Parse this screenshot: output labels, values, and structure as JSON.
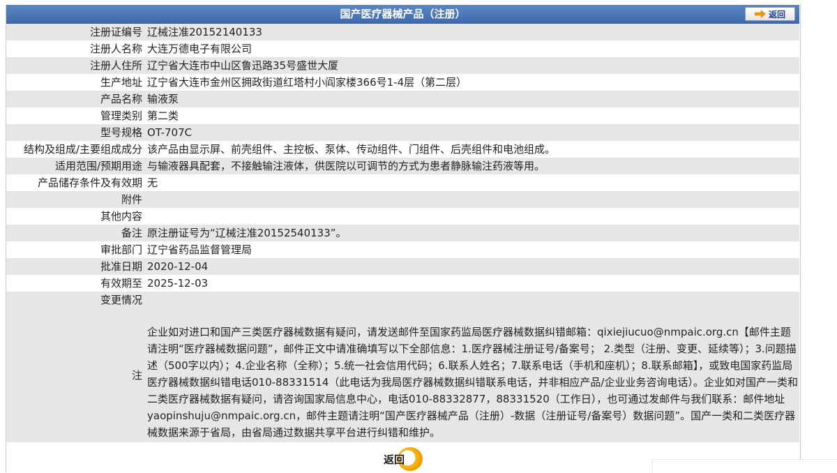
{
  "header": {
    "title": "国产医疗器械产品（注册）",
    "back_label": "返回"
  },
  "rows": [
    {
      "label": "注册证编号",
      "value": "辽械注准20152140133"
    },
    {
      "label": "注册人名称",
      "value": "大连万德电子有限公司"
    },
    {
      "label": "注册人住所",
      "value": "辽宁省大连市中山区鲁迅路35号盛世大厦"
    },
    {
      "label": "生产地址",
      "value": "辽宁省大连市金州区拥政街道红塔村小阎家楼366号1-4层（第二层）"
    },
    {
      "label": "产品名称",
      "value": "输液泵"
    },
    {
      "label": "管理类别",
      "value": "第二类"
    },
    {
      "label": "型号规格",
      "value": "OT-707C"
    },
    {
      "label": "结构及组成/主要组成成分",
      "value": "该产品由显示屏、前壳组件、主控板、泵体、传动组件、门组件、后壳组件和电池组成。"
    },
    {
      "label": "适用范围/预期用途",
      "value": "与输液器具配套，不接触输注液体，供医院以可调节的方式为患者静脉输注药液等用。"
    },
    {
      "label": "产品储存条件及有效期",
      "value": "无"
    },
    {
      "label": "附件",
      "value": ""
    },
    {
      "label": "其他内容",
      "value": ""
    },
    {
      "label": "备注",
      "value": "原注册证号为“辽械注准20152540133”。"
    },
    {
      "label": "审批部门",
      "value": "辽宁省药品监督管理局"
    },
    {
      "label": "批准日期",
      "value": "2020-12-04"
    },
    {
      "label": "有效期至",
      "value": "2025-12-03"
    },
    {
      "label": "变更情况",
      "value": ""
    }
  ],
  "note": {
    "label": "注",
    "text": "企业如对进口和国产三类医疗器械数据有疑问，请发送邮件至国家药监局医疗器械数据纠错邮箱：qixiejiucuo@nmpaic.org.cn【邮件主题请注明“医疗器械数据问题”，邮件正文中请准确填写以下全部信息：1.医疗器械注册证号/备案号； 2.类型（注册、变更、延续等）；3.问题描述（500字以内）；4.企业名称（全称）；5.统一社会信用代码；6.联系人姓名；7.联系电话（手机和座机）；8.联系邮箱】，或致电国家药监局医疗器械数据纠错电话010-88331514（此电话为我局医疗器械数据纠错联系电话，并非相应产品/企业业务咨询电话）。企业如对国产一类和二类医疗器械数据有疑问，请咨询国家局信息中心，电话010-88332877，88331520（工作日），也可通过发邮件与我们联系：邮件地址yaopinshuju@nmpaic.org.cn，邮件主题请注明“国产医疗器械产品（注册）-数据（注册证号/备案号）数据问题”。国产一类和二类医疗器械数据来源于省局，由省局通过数据共享平台进行纠错和维护。"
  },
  "footer": {
    "back_label": "返回"
  }
}
